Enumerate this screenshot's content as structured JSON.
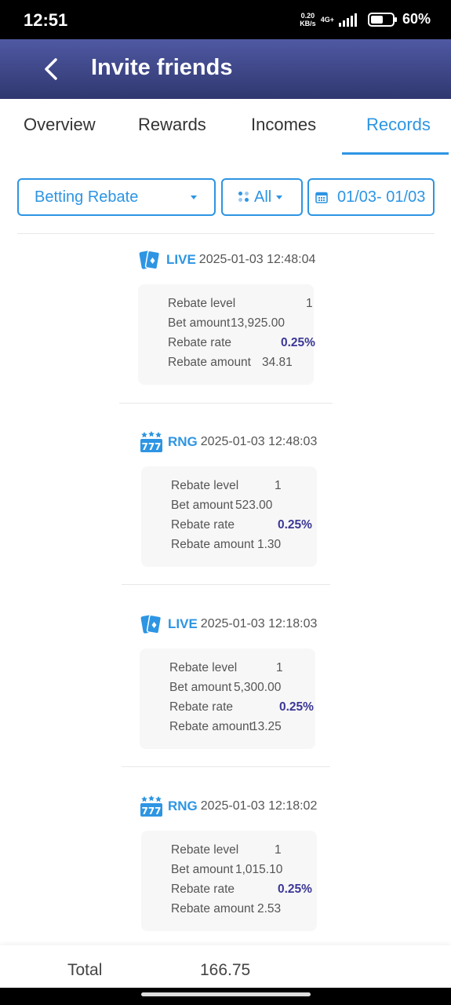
{
  "status_bar": {
    "time": "12:51",
    "net_speed_value": "0.20",
    "net_speed_unit": "KB/s",
    "network": "4G+",
    "battery_level": 60,
    "battery": "60%"
  },
  "header": {
    "title": "Invite friends",
    "back_icon": "chevron-left-icon"
  },
  "tabs": [
    {
      "label": "Overview",
      "active": false
    },
    {
      "label": "Rewards",
      "active": false
    },
    {
      "label": "Incomes",
      "active": false
    },
    {
      "label": "Records",
      "active": true
    }
  ],
  "filters": {
    "type": "Betting Rebate",
    "status": "All",
    "date_range": "01/03- 01/03"
  },
  "records": [
    {
      "game_type": "LIVE",
      "icon": "playing-cards-icon",
      "time": "2025-01-03 12:48:04",
      "rebate_level_label": "Rebate level",
      "rebate_level": "1",
      "bet_amount_label": "Bet amount",
      "bet_amount": "13,925.00",
      "rebate_rate_label": "Rebate rate",
      "rebate_rate": "0.25%",
      "rebate_amount_label": "Rebate amount",
      "rebate_amount": "34.81"
    },
    {
      "game_type": "RNG",
      "icon": "slot-777-icon",
      "time": "2025-01-03 12:48:03",
      "rebate_level_label": "Rebate level",
      "rebate_level": "1",
      "bet_amount_label": "Bet amount",
      "bet_amount": "523.00",
      "rebate_rate_label": "Rebate rate",
      "rebate_rate": "0.25%",
      "rebate_amount_label": "Rebate amount",
      "rebate_amount": "1.30"
    },
    {
      "game_type": "LIVE",
      "icon": "playing-cards-icon",
      "time": "2025-01-03 12:18:03",
      "rebate_level_label": "Rebate level",
      "rebate_level": "1",
      "bet_amount_label": "Bet amount",
      "bet_amount": "5,300.00",
      "rebate_rate_label": "Rebate rate",
      "rebate_rate": "0.25%",
      "rebate_amount_label": "Rebate amount",
      "rebate_amount": "13.25"
    },
    {
      "game_type": "RNG",
      "icon": "slot-777-icon",
      "time": "2025-01-03 12:18:02",
      "rebate_level_label": "Rebate level",
      "rebate_level": "1",
      "bet_amount_label": "Bet amount",
      "bet_amount": "1,015.10",
      "rebate_rate_label": "Rebate rate",
      "rebate_rate": "0.25%",
      "rebate_amount_label": "Rebate amount",
      "rebate_amount": "2.53"
    }
  ],
  "footer": {
    "total_label": "Total",
    "total_value": "166.75"
  },
  "colors": {
    "accent": "#2d95e3",
    "header_top": "#4f59a3",
    "header_bottom": "#30376f",
    "rate": "#3b3796"
  }
}
